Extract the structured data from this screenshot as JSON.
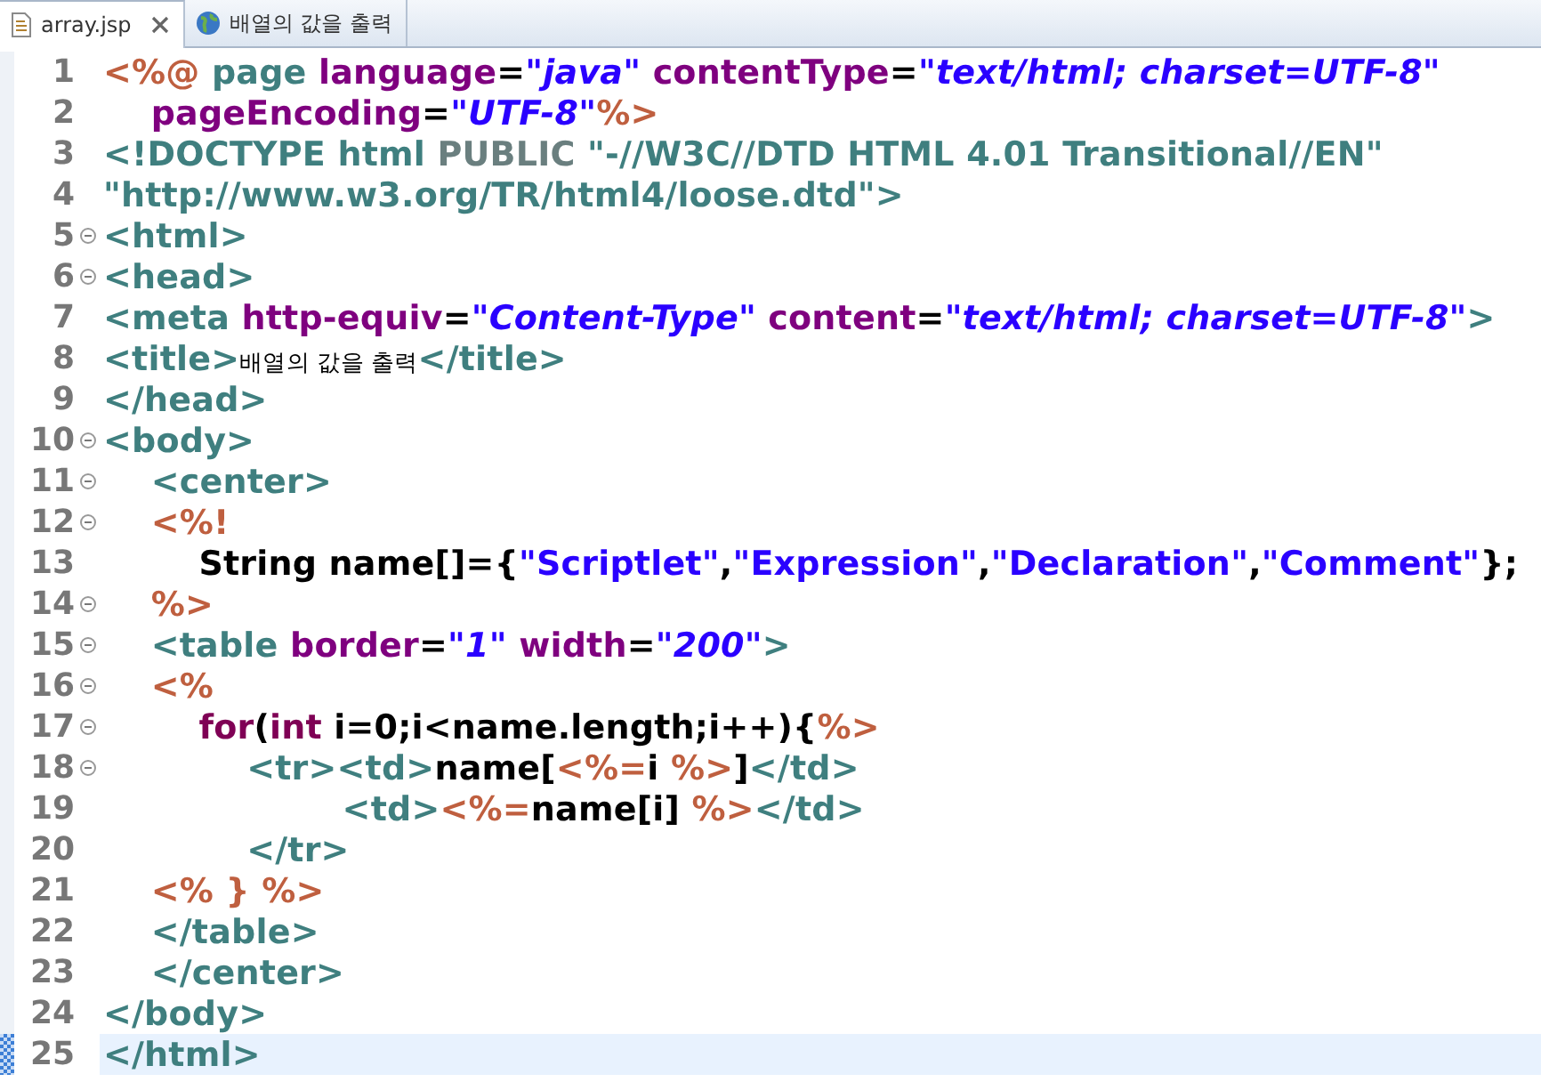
{
  "tabs": [
    {
      "label": "array.jsp",
      "kind": "file",
      "selected": true,
      "closable": true
    },
    {
      "label": "배열의 값을 출력",
      "kind": "web",
      "selected": false,
      "closable": false
    }
  ],
  "editor": {
    "lines": [
      {
        "number": "1",
        "foldable": false,
        "current": false,
        "tokens": [
          {
            "kind": "jsp",
            "text": "<%@ "
          },
          {
            "kind": "tag",
            "text": "page "
          },
          {
            "kind": "attr",
            "text": "language"
          },
          {
            "kind": "plain",
            "text": "="
          },
          {
            "kind": "value",
            "text": "\"java\" "
          },
          {
            "kind": "attr",
            "text": "contentType"
          },
          {
            "kind": "plain",
            "text": "="
          },
          {
            "kind": "value",
            "text": "\"text/html; charset=UTF-8\""
          }
        ]
      },
      {
        "number": "2",
        "foldable": false,
        "current": false,
        "tokens": [
          {
            "kind": "attr",
            "text": "    pageEncoding"
          },
          {
            "kind": "plain",
            "text": "="
          },
          {
            "kind": "value",
            "text": "\"UTF-8\""
          },
          {
            "kind": "jsp",
            "text": "%>"
          }
        ]
      },
      {
        "number": "3",
        "foldable": false,
        "current": false,
        "tokens": [
          {
            "kind": "tag",
            "text": "<!DOCTYPE html "
          },
          {
            "kind": "doctype",
            "text": "PUBLIC "
          },
          {
            "kind": "tag",
            "text": "\"-//W3C//DTD HTML 4.01 Transitional//EN\""
          }
        ]
      },
      {
        "number": "4",
        "foldable": false,
        "current": false,
        "tokens": [
          {
            "kind": "tag",
            "text": "\"http://www.w3.org/TR/html4/loose.dtd\">"
          }
        ]
      },
      {
        "number": "5",
        "foldable": true,
        "current": false,
        "tokens": [
          {
            "kind": "tag",
            "text": "<html>"
          }
        ]
      },
      {
        "number": "6",
        "foldable": true,
        "current": false,
        "tokens": [
          {
            "kind": "tag",
            "text": "<head>"
          }
        ]
      },
      {
        "number": "7",
        "foldable": false,
        "current": false,
        "tokens": [
          {
            "kind": "tag",
            "text": "<meta "
          },
          {
            "kind": "attr",
            "text": "http-equiv"
          },
          {
            "kind": "plain",
            "text": "="
          },
          {
            "kind": "value",
            "text": "\"Content-Type\" "
          },
          {
            "kind": "attr",
            "text": "content"
          },
          {
            "kind": "plain",
            "text": "="
          },
          {
            "kind": "value",
            "text": "\"text/html; charset=UTF-8\""
          },
          {
            "kind": "tag",
            "text": ">"
          }
        ]
      },
      {
        "number": "8",
        "foldable": false,
        "current": false,
        "tokens": [
          {
            "kind": "tag",
            "text": "<title>"
          },
          {
            "kind": "text",
            "text": "배열의 값을 출력"
          },
          {
            "kind": "tag",
            "text": "</title>"
          }
        ]
      },
      {
        "number": "9",
        "foldable": false,
        "current": false,
        "tokens": [
          {
            "kind": "tag",
            "text": "</head>"
          }
        ]
      },
      {
        "number": "10",
        "foldable": true,
        "current": false,
        "tokens": [
          {
            "kind": "tag",
            "text": "<body>"
          }
        ]
      },
      {
        "number": "11",
        "foldable": true,
        "current": false,
        "tokens": [
          {
            "kind": "tag",
            "text": "    <center>"
          }
        ]
      },
      {
        "number": "12",
        "foldable": true,
        "current": false,
        "tokens": [
          {
            "kind": "jsp",
            "text": "    <%!"
          }
        ]
      },
      {
        "number": "13",
        "foldable": false,
        "current": false,
        "tokens": [
          {
            "kind": "plain",
            "text": "        String name[]={"
          },
          {
            "kind": "string",
            "text": "\"Scriptlet\""
          },
          {
            "kind": "plain",
            "text": ","
          },
          {
            "kind": "string",
            "text": "\"Expression\""
          },
          {
            "kind": "plain",
            "text": ","
          },
          {
            "kind": "string",
            "text": "\"Declaration\""
          },
          {
            "kind": "plain",
            "text": ","
          },
          {
            "kind": "string",
            "text": "\"Comment\""
          },
          {
            "kind": "plain",
            "text": "};"
          }
        ]
      },
      {
        "number": "14",
        "foldable": true,
        "current": false,
        "tokens": [
          {
            "kind": "jsp",
            "text": "    %>"
          }
        ]
      },
      {
        "number": "15",
        "foldable": true,
        "current": false,
        "tokens": [
          {
            "kind": "tag",
            "text": "    <table "
          },
          {
            "kind": "attr",
            "text": "border"
          },
          {
            "kind": "plain",
            "text": "="
          },
          {
            "kind": "value",
            "text": "\"1\" "
          },
          {
            "kind": "attr",
            "text": "width"
          },
          {
            "kind": "plain",
            "text": "="
          },
          {
            "kind": "value",
            "text": "\"200\""
          },
          {
            "kind": "tag",
            "text": ">"
          }
        ]
      },
      {
        "number": "16",
        "foldable": true,
        "current": false,
        "tokens": [
          {
            "kind": "jsp",
            "text": "    <%"
          }
        ]
      },
      {
        "number": "17",
        "foldable": true,
        "current": false,
        "tokens": [
          {
            "kind": "keyword",
            "text": "        for"
          },
          {
            "kind": "plain",
            "text": "("
          },
          {
            "kind": "keyword",
            "text": "int"
          },
          {
            "kind": "plain",
            "text": " i=0;i<name.length;i++){"
          },
          {
            "kind": "jsp",
            "text": "%>"
          }
        ]
      },
      {
        "number": "18",
        "foldable": true,
        "current": false,
        "tokens": [
          {
            "kind": "tag",
            "text": "            <tr><td>"
          },
          {
            "kind": "plain",
            "text": "name["
          },
          {
            "kind": "jsp",
            "text": "<%="
          },
          {
            "kind": "plain",
            "text": "i "
          },
          {
            "kind": "jsp",
            "text": "%>"
          },
          {
            "kind": "plain",
            "text": "]"
          },
          {
            "kind": "tag",
            "text": "</td>"
          }
        ]
      },
      {
        "number": "19",
        "foldable": false,
        "current": false,
        "tokens": [
          {
            "kind": "tag",
            "text": "                    <td>"
          },
          {
            "kind": "jsp",
            "text": "<%="
          },
          {
            "kind": "plain",
            "text": "name[i] "
          },
          {
            "kind": "jsp",
            "text": "%>"
          },
          {
            "kind": "tag",
            "text": "</td>"
          }
        ]
      },
      {
        "number": "20",
        "foldable": false,
        "current": false,
        "tokens": [
          {
            "kind": "tag",
            "text": "            </tr>"
          }
        ]
      },
      {
        "number": "21",
        "foldable": false,
        "current": false,
        "tokens": [
          {
            "kind": "jsp",
            "text": "    <% } %>"
          }
        ]
      },
      {
        "number": "22",
        "foldable": false,
        "current": false,
        "tokens": [
          {
            "kind": "tag",
            "text": "    </table>"
          }
        ]
      },
      {
        "number": "23",
        "foldable": false,
        "current": false,
        "tokens": [
          {
            "kind": "tag",
            "text": "    </center>"
          }
        ]
      },
      {
        "number": "24",
        "foldable": false,
        "current": false,
        "tokens": [
          {
            "kind": "tag",
            "text": "</body>"
          }
        ]
      },
      {
        "number": "25",
        "foldable": false,
        "current": true,
        "tokens": [
          {
            "kind": "tag",
            "text": "</html>"
          }
        ]
      }
    ]
  }
}
